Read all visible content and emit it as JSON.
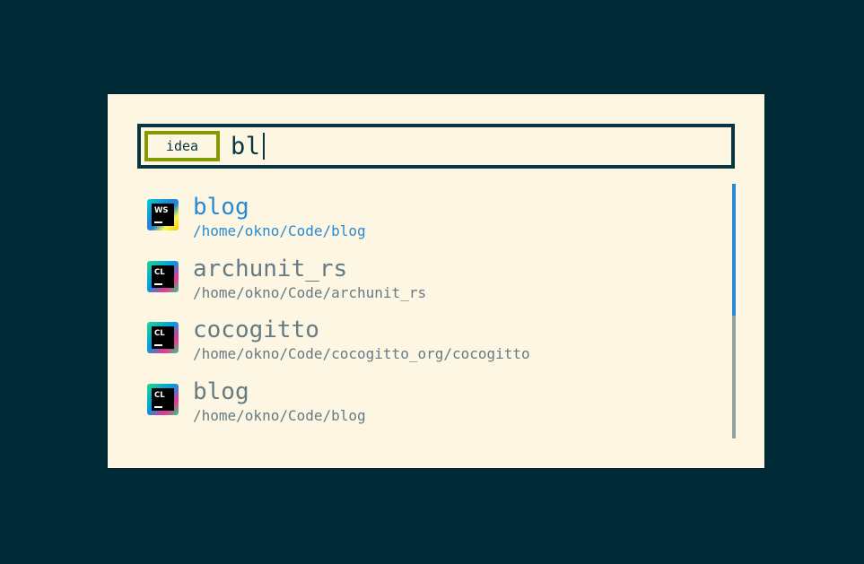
{
  "search": {
    "mode": "idea",
    "query": "bl"
  },
  "results": [
    {
      "name": "blog",
      "path": "/home/okno/Code/blog",
      "icon": "webstorm-icon",
      "icon_label": "WS",
      "selected": true
    },
    {
      "name": "archunit_rs",
      "path": "/home/okno/Code/archunit_rs",
      "icon": "clion-icon",
      "icon_label": "CL",
      "selected": false
    },
    {
      "name": "cocogitto",
      "path": "/home/okno/Code/cocogitto_org/cocogitto",
      "icon": "clion-icon",
      "icon_label": "CL",
      "selected": false
    },
    {
      "name": "blog",
      "path": "/home/okno/Code/blog",
      "icon": "clion-icon",
      "icon_label": "CL",
      "selected": false
    }
  ],
  "colors": {
    "background": "#002b36",
    "panel": "#fdf6e3",
    "border": "#073642",
    "mode_border": "#859900",
    "selected": "#268bd2",
    "text": "#657b83"
  }
}
